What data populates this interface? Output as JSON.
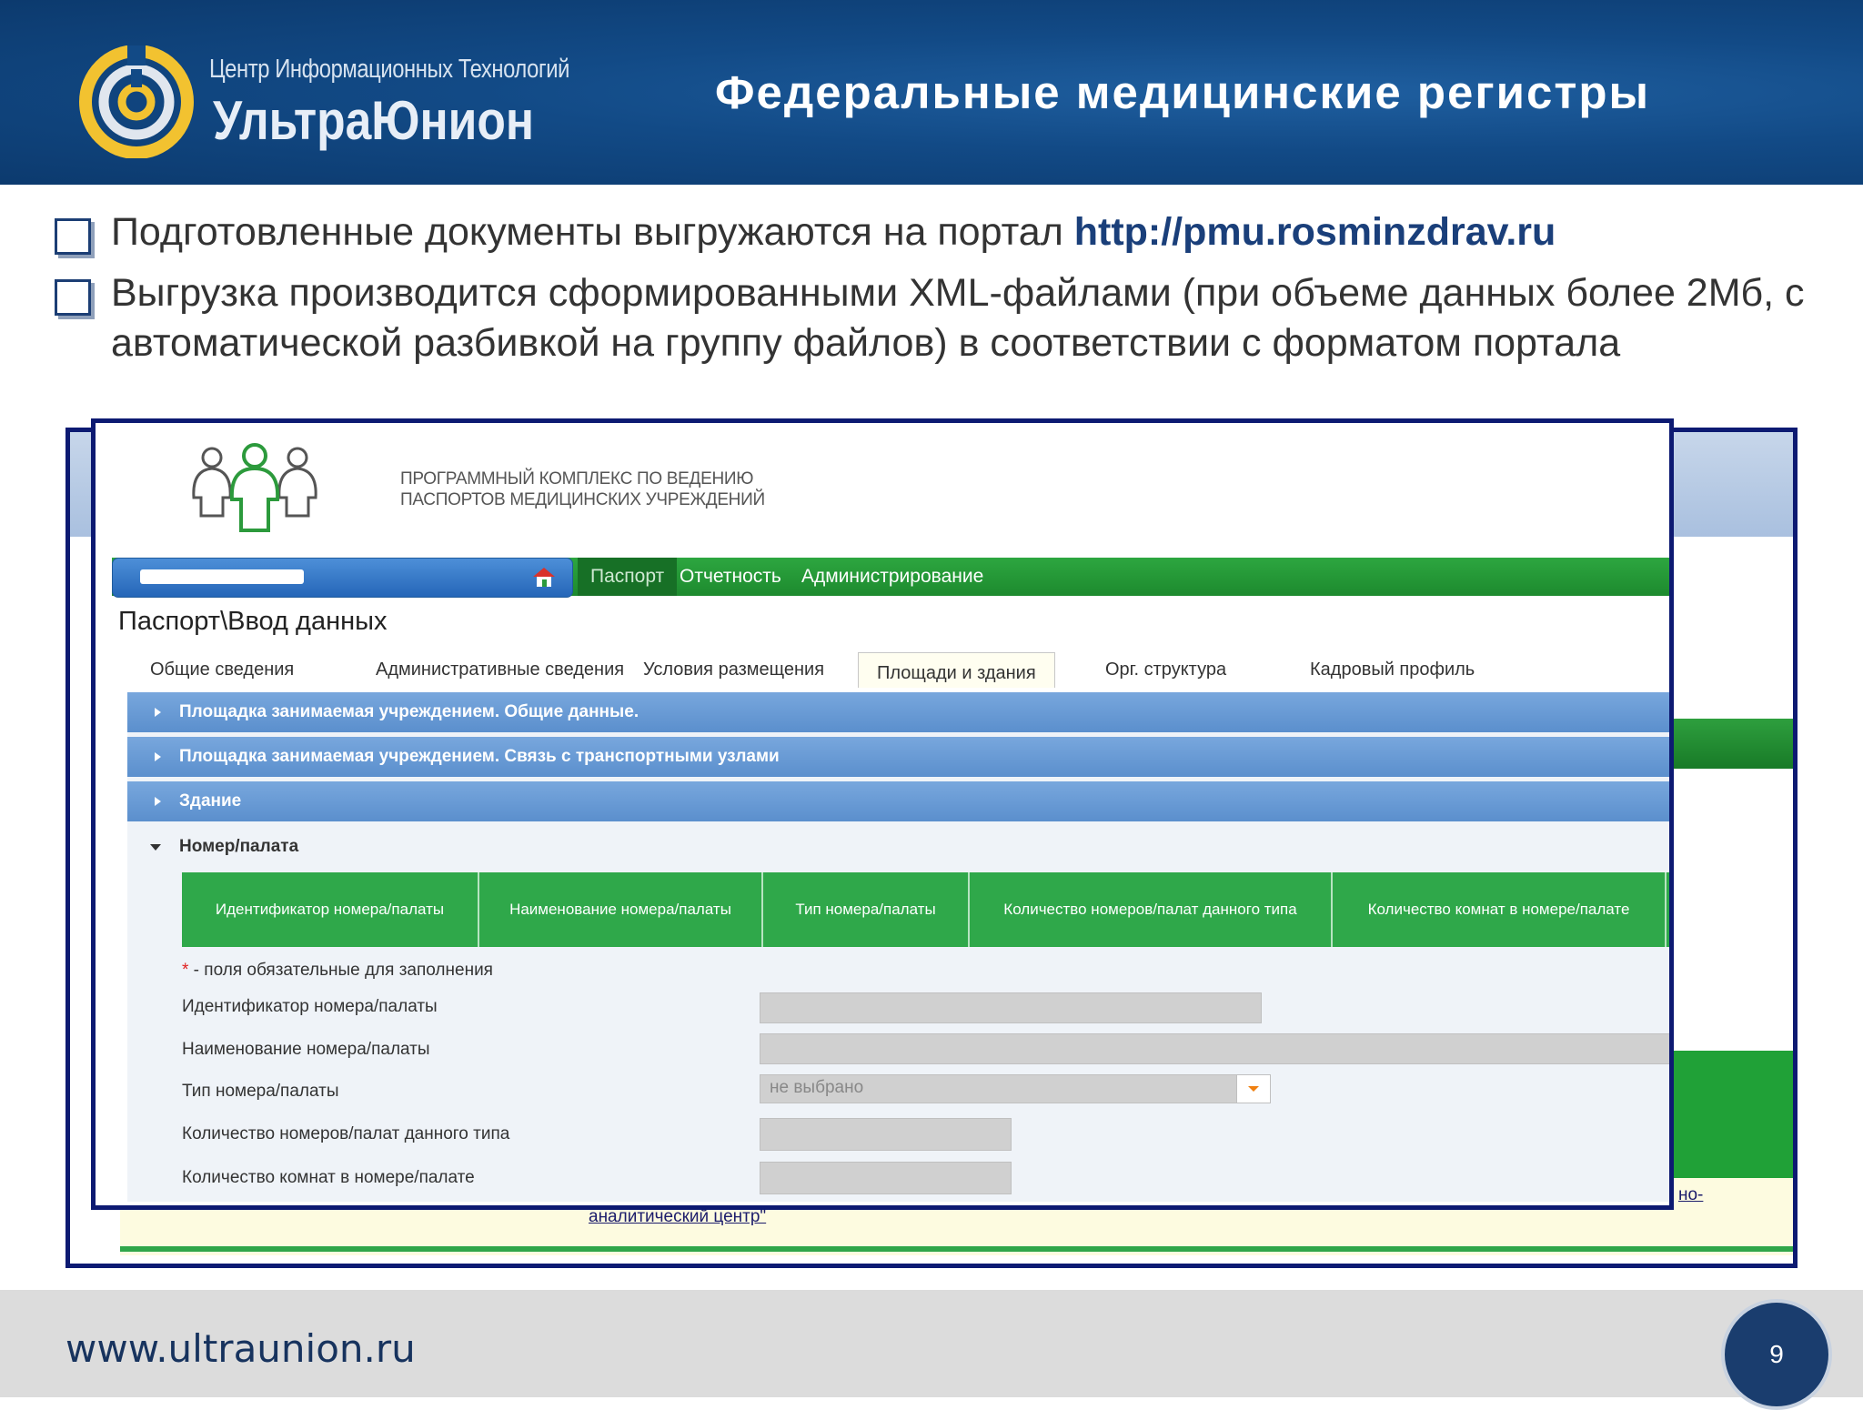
{
  "header": {
    "company_line": "Центр Информационных Технологий",
    "company_name": "УльтраЮнион",
    "slide_title": "Федеральные медицинские регистры"
  },
  "bullets": {
    "b1_text": "Подготовленные документы выгружаются на портал ",
    "b1_link": "http://pmu.rosminzdrav.ru",
    "b2_text": "Выгрузка производится сформированными XML-файлами (при объеме данных более 2Мб, с автоматической разбивкой на группу файлов) в соответствии с форматом портала"
  },
  "app": {
    "title_line1": "ПРОГРАММНЫЙ КОМПЛЕКС ПО ВЕДЕНИЮ",
    "title_line2": "ПАСПОРТОВ МЕДИЦИНСКИХ УЧРЕЖДЕНИЙ",
    "nav": [
      "Паспорт",
      "Отчетность",
      "Администрирование"
    ],
    "breadcrumb": "Паспорт\\Ввод данных",
    "tabs": [
      "Общие сведения",
      "Административные сведения",
      "Условия размещения",
      "Площади и здания",
      "Орг. структура",
      "Кадровый профиль"
    ],
    "active_tab": "Площади и здания",
    "accordion": [
      "Площадка занимаемая учреждением. Общие данные.",
      "Площадка занимаемая учреждением. Связь с транспортными узлами",
      "Здание"
    ],
    "open_section": "Номер/палата",
    "grid_headers": [
      "Идентификатор номера/палаты",
      "Наименование номера/палаты",
      "Тип номера/палаты",
      "Количество номеров/палат данного типа",
      "Количество комнат в номере/палате"
    ],
    "required_star": "*",
    "required_note": " - поля обязательные для заполнения",
    "fields": {
      "id_label": "Идентификатор номера/палаты",
      "name_label": "Наименование номера/палаты",
      "type_label": "Тип номера/палаты",
      "type_value": "не выбрано",
      "count_label": "Количество номеров/палат данного типа",
      "rooms_label": "Количество комнат в номере/палате"
    },
    "background_link_1": "аналитический центр\"",
    "background_link_2": "но-"
  },
  "footer": {
    "site": "www.ultraunion.ru",
    "page_number": "9"
  },
  "colors": {
    "header_blue": "#124a86",
    "nav_green": "#2da640",
    "accordion_blue": "#6a9bd4",
    "frame_navy": "#0d1a72"
  }
}
